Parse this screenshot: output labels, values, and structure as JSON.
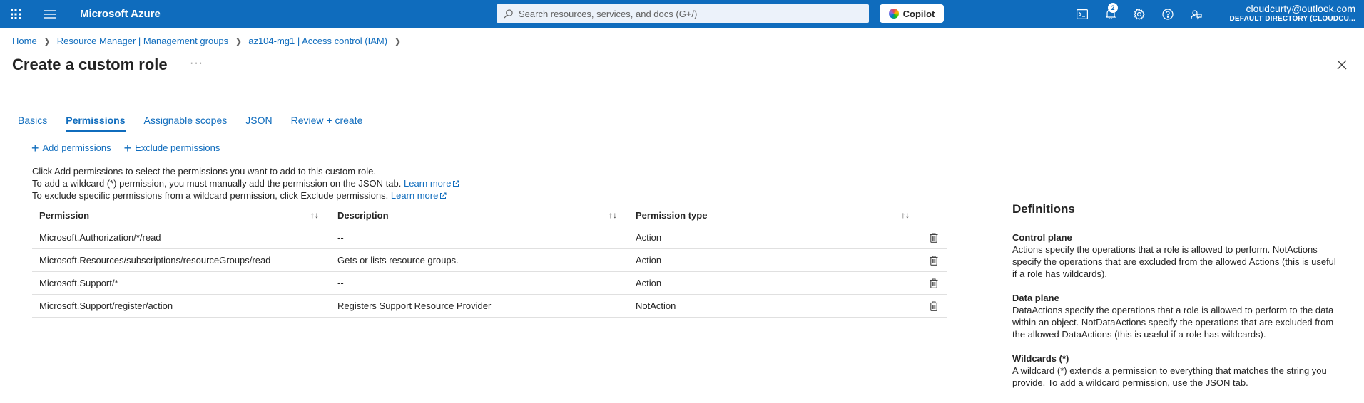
{
  "topbar": {
    "brand": "Microsoft Azure",
    "search_placeholder": "Search resources, services, and docs (G+/)",
    "copilot_label": "Copilot",
    "notification_count": "2",
    "account_email": "cloudcurty@outlook.com",
    "account_directory": "DEFAULT DIRECTORY (CLOUDCU..."
  },
  "breadcrumb": [
    "Home",
    "Resource Manager | Management groups",
    "az104-mg1 | Access control (IAM)"
  ],
  "page": {
    "title": "Create a custom role",
    "more": "···"
  },
  "tabs": [
    "Basics",
    "Permissions",
    "Assignable scopes",
    "JSON",
    "Review + create"
  ],
  "active_tab": "Permissions",
  "commands": {
    "add": "Add permissions",
    "exclude": "Exclude permissions"
  },
  "info": {
    "line1": "Click Add permissions to select the permissions you want to add to this custom role.",
    "line2": "To add a wildcard (*) permission, you must manually add the permission on the JSON tab.",
    "line3": "To exclude specific permissions from a wildcard permission, click Exclude permissions.",
    "learn_more": "Learn more"
  },
  "table": {
    "headers": [
      "Permission",
      "Description",
      "Permission type"
    ],
    "rows": [
      {
        "permission": "Microsoft.Authorization/*/read",
        "description": "--",
        "type": "Action"
      },
      {
        "permission": "Microsoft.Resources/subscriptions/resourceGroups/read",
        "description": "Gets or lists resource groups.",
        "type": "Action"
      },
      {
        "permission": "Microsoft.Support/*",
        "description": "--",
        "type": "Action"
      },
      {
        "permission": "Microsoft.Support/register/action",
        "description": "Registers Support Resource Provider",
        "type": "NotAction"
      }
    ]
  },
  "definitions": {
    "title": "Definitions",
    "sections": [
      {
        "heading": "Control plane",
        "text": "Actions specify the operations that a role is allowed to perform. NotActions specify the operations that are excluded from the allowed Actions (this is useful if a role has wildcards)."
      },
      {
        "heading": "Data plane",
        "text": "DataActions specify the operations that a role is allowed to perform to the data within an object. NotDataActions specify the operations that are excluded from the allowed DataActions (this is useful if a role has wildcards)."
      },
      {
        "heading": "Wildcards (*)",
        "text": "A wildcard (*) extends a permission to everything that matches the string you provide. To add a wildcard permission, use the JSON tab."
      }
    ]
  }
}
